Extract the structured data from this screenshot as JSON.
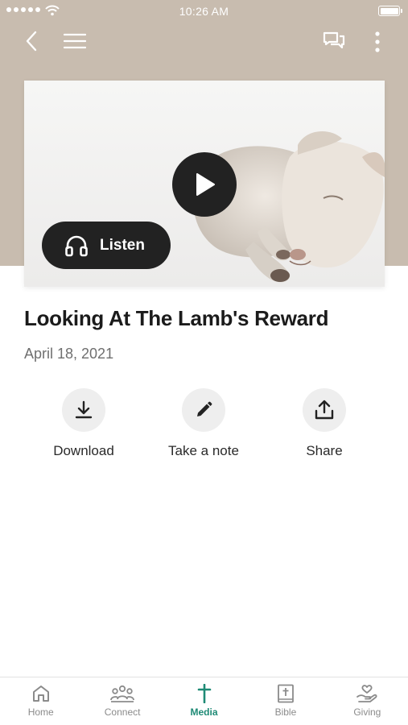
{
  "status_bar": {
    "time": "10:26 AM"
  },
  "media": {
    "listen_label": "Listen"
  },
  "sermon": {
    "title": "Looking At The Lamb's Reward",
    "date": "April 18, 2021"
  },
  "actions": [
    {
      "label": "Download",
      "icon": "download-icon"
    },
    {
      "label": "Take a note",
      "icon": "pencil-icon"
    },
    {
      "label": "Share",
      "icon": "share-icon"
    }
  ],
  "tabs": [
    {
      "label": "Home",
      "icon": "home-icon"
    },
    {
      "label": "Connect",
      "icon": "people-icon"
    },
    {
      "label": "Media",
      "icon": "cross-icon",
      "active": true
    },
    {
      "label": "Bible",
      "icon": "bible-icon"
    },
    {
      "label": "Giving",
      "icon": "giving-heart-icon"
    }
  ],
  "colors": {
    "header_background": "#c8bcaf",
    "accent": "#1e8a75",
    "button_dark": "#222222"
  }
}
